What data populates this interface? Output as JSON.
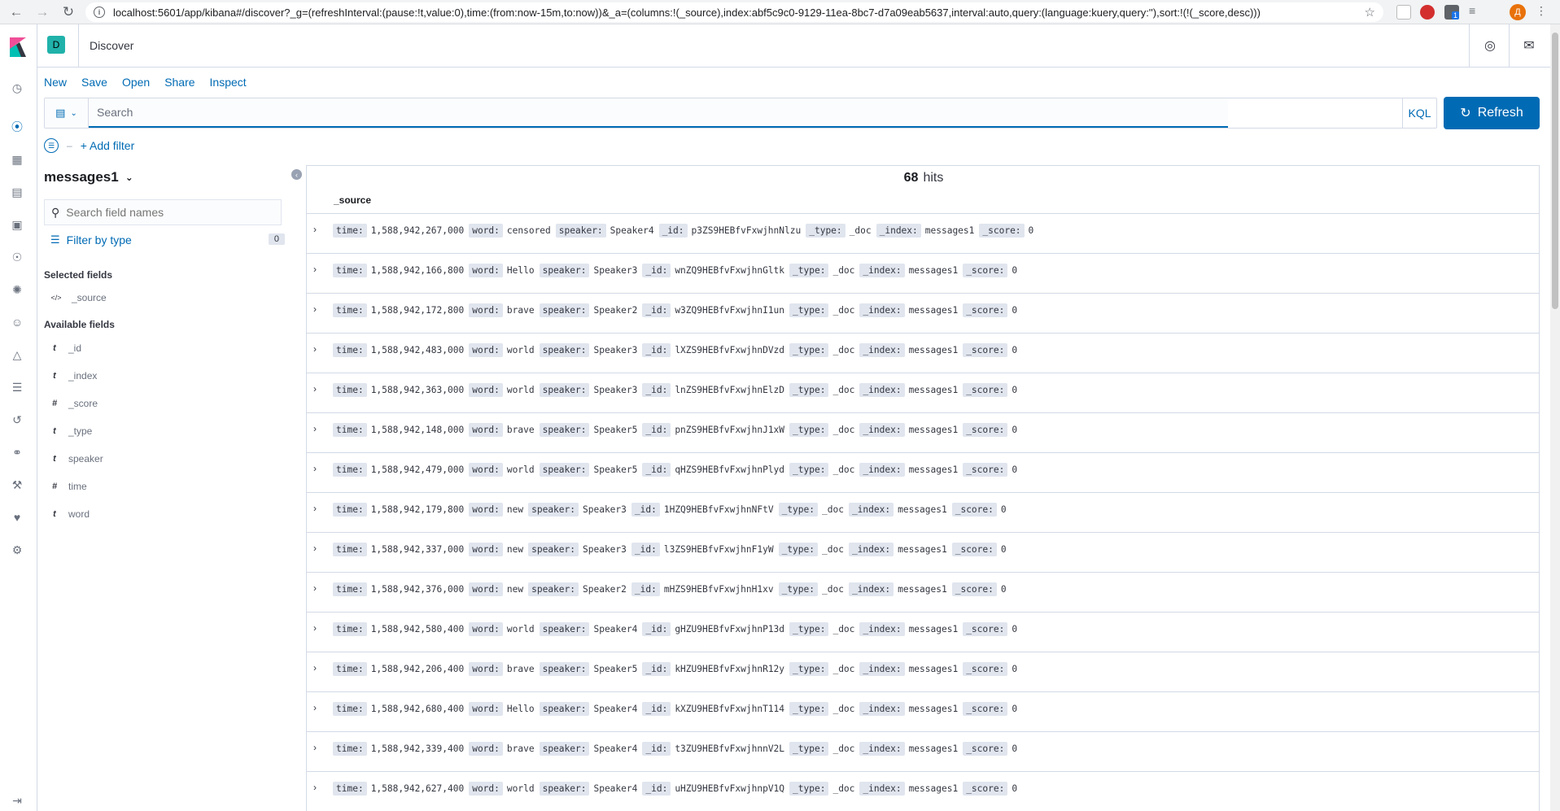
{
  "browser": {
    "url": "localhost:5601/app/kibana#/discover?_g=(refreshInterval:(pause:!t,value:0),time:(from:now-15m,to:now))&_a=(columns:!(_source),index:abf5c9c0-9129-11ea-8bc7-d7a09eab5637,interval:auto,query:(language:kuery,query:''),sort:!(!(_score,desc)))",
    "avatar_letter": "Д",
    "ext_badge": "1"
  },
  "header": {
    "space_letter": "D",
    "title": "Discover"
  },
  "topmenu": [
    "New",
    "Save",
    "Open",
    "Share",
    "Inspect"
  ],
  "query": {
    "placeholder": "Search",
    "language": "KQL",
    "refresh_label": "Refresh"
  },
  "filter": {
    "add_label": "+ Add filter"
  },
  "sidebar": {
    "index_pattern": "messages1",
    "field_search_placeholder": "Search field names",
    "filter_by_type": "Filter by type",
    "filter_count": "0",
    "selected_title": "Selected fields",
    "selected_fields": [
      {
        "type": "</>",
        "name": "_source"
      }
    ],
    "available_title": "Available fields",
    "available_fields": [
      {
        "type": "t",
        "name": "_id"
      },
      {
        "type": "t",
        "name": "_index"
      },
      {
        "type": "#",
        "name": "_score"
      },
      {
        "type": "t",
        "name": "_type"
      },
      {
        "type": "t",
        "name": "speaker"
      },
      {
        "type": "#",
        "name": "time"
      },
      {
        "type": "t",
        "name": "word"
      }
    ]
  },
  "results": {
    "hits_count": "68",
    "hits_label": "hits",
    "column": "_source",
    "rows": [
      {
        "time": "1,588,942,267,000",
        "word": "censored",
        "speaker": "Speaker4",
        "_id": "p3ZS9HEBfvFxwjhnNlzu",
        "_type": "_doc",
        "_index": "messages1",
        "_score": "0"
      },
      {
        "time": "1,588,942,166,800",
        "word": "Hello",
        "speaker": "Speaker3",
        "_id": "wnZQ9HEBfvFxwjhnGltk",
        "_type": "_doc",
        "_index": "messages1",
        "_score": "0"
      },
      {
        "time": "1,588,942,172,800",
        "word": "brave",
        "speaker": "Speaker2",
        "_id": "w3ZQ9HEBfvFxwjhnI1un",
        "_type": "_doc",
        "_index": "messages1",
        "_score": "0"
      },
      {
        "time": "1,588,942,483,000",
        "word": "world",
        "speaker": "Speaker3",
        "_id": "lXZS9HEBfvFxwjhnDVzd",
        "_type": "_doc",
        "_index": "messages1",
        "_score": "0"
      },
      {
        "time": "1,588,942,363,000",
        "word": "world",
        "speaker": "Speaker3",
        "_id": "lnZS9HEBfvFxwjhnElzD",
        "_type": "_doc",
        "_index": "messages1",
        "_score": "0"
      },
      {
        "time": "1,588,942,148,000",
        "word": "brave",
        "speaker": "Speaker5",
        "_id": "pnZS9HEBfvFxwjhnJ1xW",
        "_type": "_doc",
        "_index": "messages1",
        "_score": "0"
      },
      {
        "time": "1,588,942,479,000",
        "word": "world",
        "speaker": "Speaker5",
        "_id": "qHZS9HEBfvFxwjhnPlyd",
        "_type": "_doc",
        "_index": "messages1",
        "_score": "0"
      },
      {
        "time": "1,588,942,179,800",
        "word": "new",
        "speaker": "Speaker3",
        "_id": "1HZQ9HEBfvFxwjhnNFtV",
        "_type": "_doc",
        "_index": "messages1",
        "_score": "0"
      },
      {
        "time": "1,588,942,337,000",
        "word": "new",
        "speaker": "Speaker3",
        "_id": "l3ZS9HEBfvFxwjhnF1yW",
        "_type": "_doc",
        "_index": "messages1",
        "_score": "0"
      },
      {
        "time": "1,588,942,376,000",
        "word": "new",
        "speaker": "Speaker2",
        "_id": "mHZS9HEBfvFxwjhnH1xv",
        "_type": "_doc",
        "_index": "messages1",
        "_score": "0"
      },
      {
        "time": "1,588,942,580,400",
        "word": "world",
        "speaker": "Speaker4",
        "_id": "gHZU9HEBfvFxwjhnP13d",
        "_type": "_doc",
        "_index": "messages1",
        "_score": "0"
      },
      {
        "time": "1,588,942,206,400",
        "word": "brave",
        "speaker": "Speaker5",
        "_id": "kHZU9HEBfvFxwjhnR12y",
        "_type": "_doc",
        "_index": "messages1",
        "_score": "0"
      },
      {
        "time": "1,588,942,680,400",
        "word": "Hello",
        "speaker": "Speaker4",
        "_id": "kXZU9HEBfvFxwjhnT114",
        "_type": "_doc",
        "_index": "messages1",
        "_score": "0"
      },
      {
        "time": "1,588,942,339,400",
        "word": "brave",
        "speaker": "Speaker4",
        "_id": "t3ZU9HEBfvFxwjhnnV2L",
        "_type": "_doc",
        "_index": "messages1",
        "_score": "0"
      },
      {
        "time": "1,588,942,627,400",
        "word": "world",
        "speaker": "Speaker4",
        "_id": "uHZU9HEBfvFxwjhnpV1Q",
        "_type": "_doc",
        "_index": "messages1",
        "_score": "0"
      }
    ]
  },
  "colors": {
    "accent": "#006bb4",
    "space_badge": "#20b2aa"
  }
}
